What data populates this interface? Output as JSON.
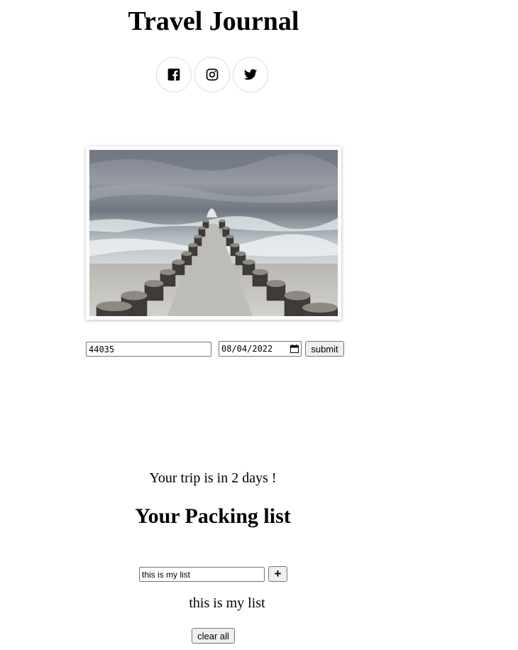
{
  "header": {
    "title": "Travel Journal",
    "social": [
      {
        "icon": "facebook-icon"
      },
      {
        "icon": "instagram-icon"
      },
      {
        "icon": "twitter-icon"
      }
    ]
  },
  "photo": {
    "subject": "wooden breakwater posts leading into stormy sea"
  },
  "trip_form": {
    "zip_value": "44035",
    "date_value": "08/04/2022",
    "submit_label": "submit"
  },
  "countdown_text": "Your trip is in 2 days !",
  "packing": {
    "title": "Your Packing list",
    "input_value": "this is my list",
    "add_label": "+",
    "items": [
      "this is my list"
    ],
    "clear_label": "clear all"
  }
}
